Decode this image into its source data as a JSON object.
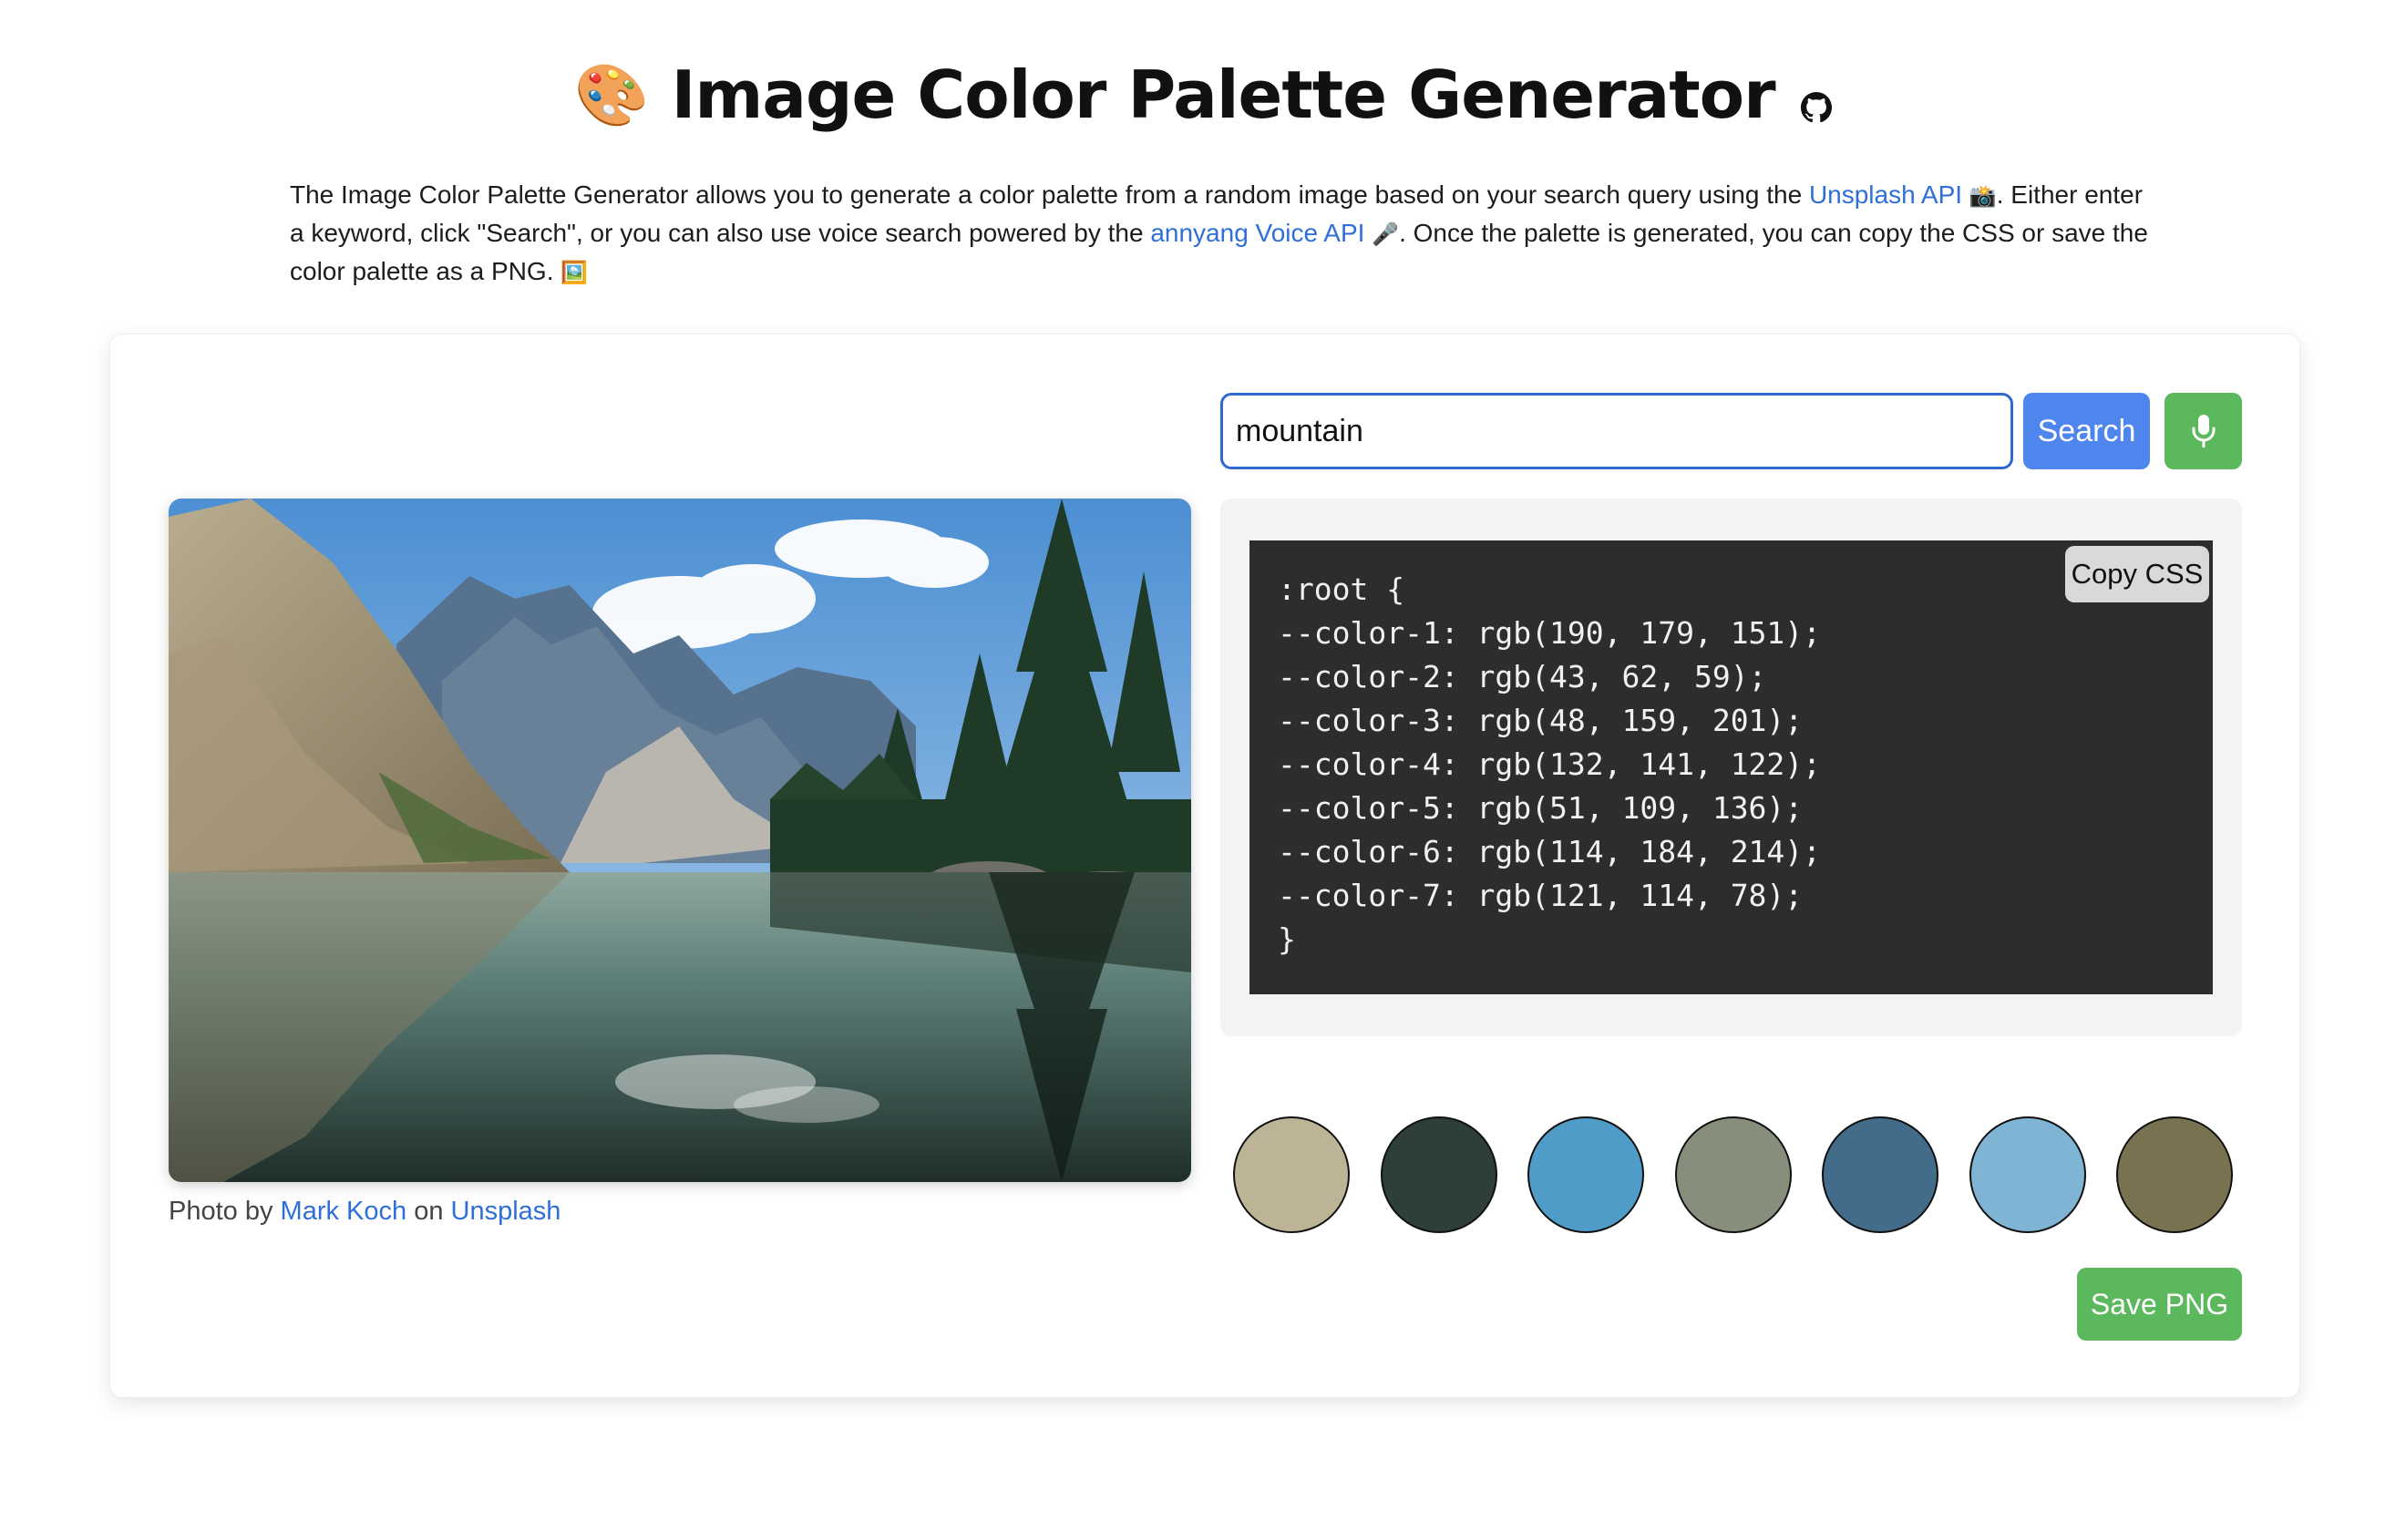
{
  "header": {
    "title_emoji": "🎨",
    "title": "Image Color Palette Generator",
    "github_icon": "github-icon"
  },
  "intro": {
    "part1": "The Image Color Palette Generator allows you to generate a color palette from a random image based on your search query using the ",
    "link_unsplash_api": "Unsplash API",
    "emoji_camera": "📸",
    "part2": ". Either enter a keyword, click \"Search\", or you can also use voice search powered by the ",
    "link_annyang": "annyang Voice API",
    "emoji_mic": "🎤",
    "part3": ". Once the palette is generated, you can copy the CSS or save the color palette as a PNG. ",
    "emoji_picture": "🖼️"
  },
  "search": {
    "value": "mountain",
    "button_label": "Search",
    "mic_icon": "microphone-icon"
  },
  "photo": {
    "credit_prefix": "Photo by ",
    "author": "Mark Koch",
    "credit_mid": " on ",
    "source": "Unsplash"
  },
  "css_panel": {
    "copy_label": "Copy CSS",
    "lines": [
      ":root {",
      "--color-1: rgb(190, 179, 151);",
      "--color-2: rgb(43, 62, 59);",
      "--color-3: rgb(48, 159, 201);",
      "--color-4: rgb(132, 141, 122);",
      "--color-5: rgb(51, 109, 136);",
      "--color-6: rgb(114, 184, 214);",
      "--color-7: rgb(121, 114, 78);",
      "}"
    ]
  },
  "palette": [
    "#bdb397",
    "#2e3e3a",
    "#4f9cc8",
    "#878e7c",
    "#436c8a",
    "#80b4d4",
    "#797250"
  ],
  "save_label": "Save PNG",
  "colors": {
    "link": "#2f6fd8",
    "primary_button": "#4f86ee",
    "success_button": "#5cb85c",
    "code_bg": "#2d2d2d"
  }
}
